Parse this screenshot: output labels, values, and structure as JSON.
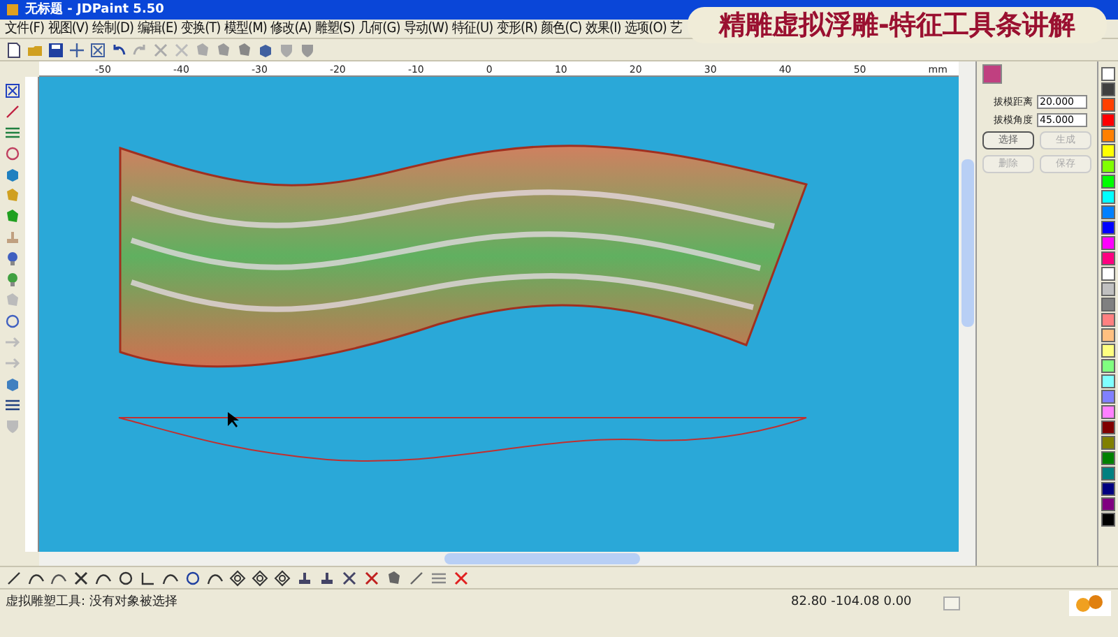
{
  "window": {
    "title": "无标题 - JDPaint 5.50"
  },
  "banner": {
    "text": "精雕虚拟浮雕-特征工具条讲解"
  },
  "menu": [
    "文件(F)",
    "视图(V)",
    "绘制(D)",
    "编辑(E)",
    "变换(T)",
    "模型(M)",
    "修改(A)",
    "雕塑(S)",
    "几何(G)",
    "导动(W)",
    "特征(U)",
    "变形(R)",
    "颜色(C)",
    "效果(I)",
    "选项(O)",
    "艺"
  ],
  "ruler": {
    "labels": [
      "-50",
      "-40",
      "-30",
      "-20",
      "-10",
      "0",
      "10",
      "20",
      "30",
      "40",
      "50"
    ],
    "unit": "mm"
  },
  "panel": {
    "fields": [
      {
        "label": "拔模距离",
        "value": "20.000"
      },
      {
        "label": "拔模角度",
        "value": "45.000"
      }
    ],
    "buttons": [
      {
        "label": "选择",
        "disabled": false
      },
      {
        "label": "生成",
        "disabled": true
      },
      {
        "label": "删除",
        "disabled": true
      },
      {
        "label": "保存",
        "disabled": true
      }
    ]
  },
  "palette": [
    {
      "color": "#ffffff"
    },
    {
      "color": "#404040"
    },
    {
      "color": "#ff4000"
    },
    {
      "color": "#ff0000"
    },
    {
      "color": "#ff8000"
    },
    {
      "color": "#ffff00"
    },
    {
      "color": "#80ff00"
    },
    {
      "color": "#00ff00"
    },
    {
      "color": "#00ffff"
    },
    {
      "color": "#0080ff"
    },
    {
      "color": "#0000ff"
    },
    {
      "color": "#ff00ff"
    },
    {
      "color": "#ff0080"
    },
    {
      "color": "#ffffff"
    },
    {
      "color": "#c0c0c0"
    },
    {
      "color": "#808080"
    },
    {
      "color": "#ff8080"
    },
    {
      "color": "#ffc080"
    },
    {
      "color": "#ffff80"
    },
    {
      "color": "#80ff80"
    },
    {
      "color": "#80ffff"
    },
    {
      "color": "#8080ff"
    },
    {
      "color": "#ff80ff"
    },
    {
      "color": "#800000"
    },
    {
      "color": "#808000"
    },
    {
      "color": "#008000"
    },
    {
      "color": "#008080"
    },
    {
      "color": "#000080"
    },
    {
      "color": "#800080"
    },
    {
      "color": "#000000"
    }
  ],
  "status_bar": {
    "message": "虚拟雕塑工具: 没有对象被选择",
    "coordinates": "82.80 -104.08 0.00"
  }
}
